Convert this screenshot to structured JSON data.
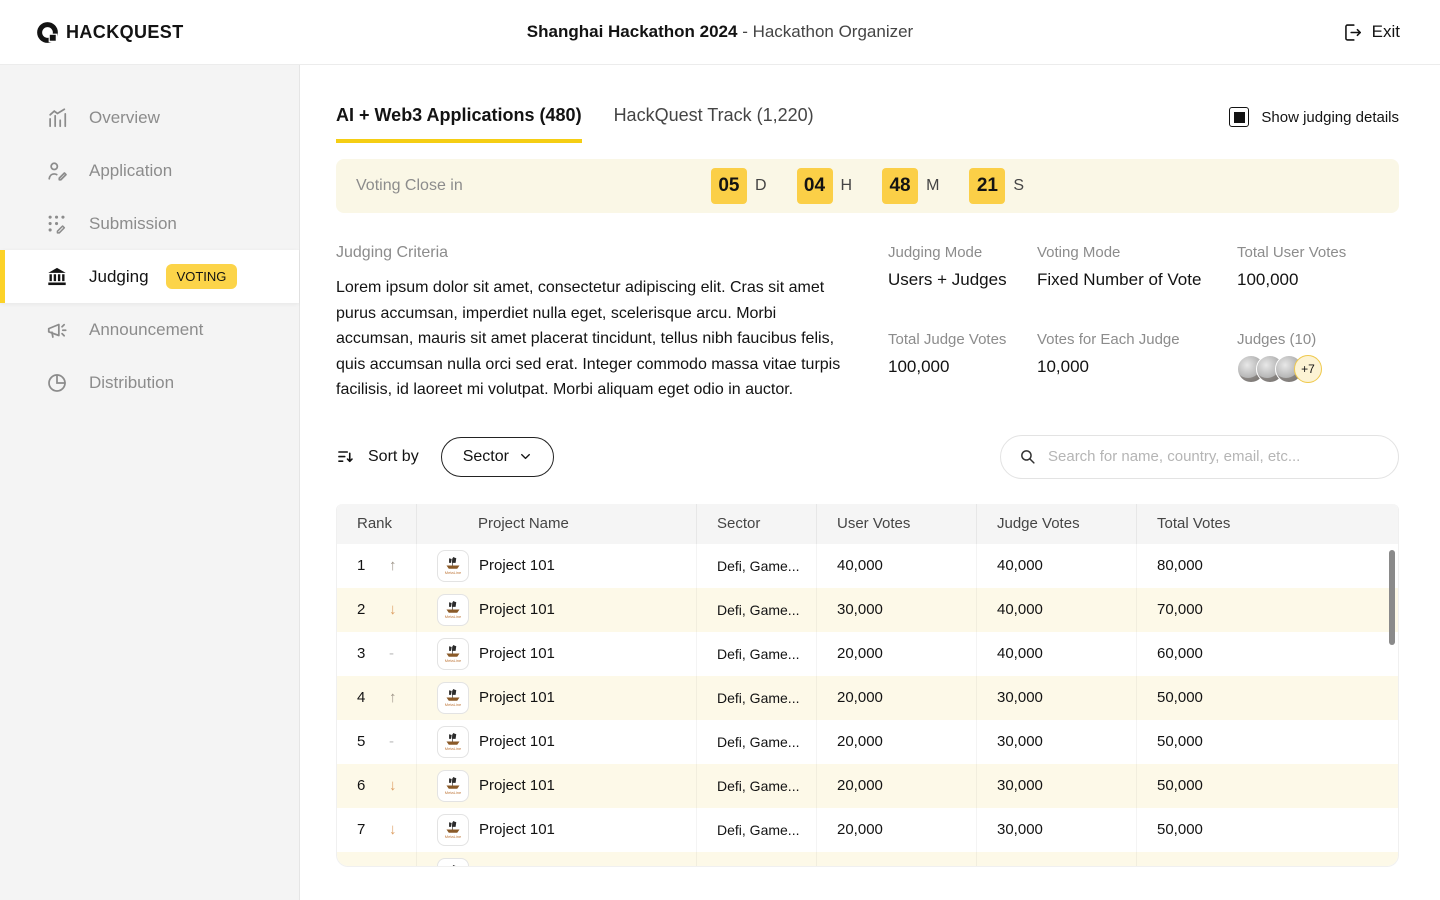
{
  "header": {
    "logo_text": "HACKQUEST",
    "title": "Shanghai Hackathon 2024",
    "subtitle": " - Hackathon Organizer",
    "exit_label": "Exit"
  },
  "sidebar": {
    "items": [
      {
        "label": "Overview",
        "icon": "chart-icon",
        "active": false
      },
      {
        "label": "Application",
        "icon": "user-edit-icon",
        "active": false
      },
      {
        "label": "Submission",
        "icon": "grid-edit-icon",
        "active": false
      },
      {
        "label": "Judging",
        "icon": "courthouse-icon",
        "active": true,
        "badge": "VOTING"
      },
      {
        "label": "Announcement",
        "icon": "megaphone-icon",
        "active": false
      },
      {
        "label": "Distribution",
        "icon": "pie-chart-icon",
        "active": false
      }
    ]
  },
  "tabs": [
    {
      "label": "AI + Web3 Applications (480)",
      "active": true
    },
    {
      "label": "HackQuest Track (1,220)",
      "active": false
    }
  ],
  "show_judging_details": {
    "label": "Show judging details",
    "checked": true
  },
  "countdown": {
    "label": "Voting Close in",
    "units": [
      {
        "value": "05",
        "unit": "D"
      },
      {
        "value": "04",
        "unit": "H"
      },
      {
        "value": "48",
        "unit": "M"
      },
      {
        "value": "21",
        "unit": "S"
      }
    ]
  },
  "criteria": {
    "label": "Judging Criteria",
    "text": "Lorem ipsum dolor sit amet, consectetur adipiscing elit. Cras sit amet purus accumsan, imperdiet nulla eget, scelerisque arcu. Morbi accumsan, mauris sit amet placerat tincidunt, tellus nibh faucibus felis, quis accumsan nulla orci sed erat. Integer commodo massa vitae turpis facilisis, id laoreet mi volutpat. Morbi aliquam eget odio in auctor."
  },
  "stats": [
    {
      "label": "Judging Mode",
      "value": "Users + Judges"
    },
    {
      "label": "Voting Mode",
      "value": "Fixed Number of Vote"
    },
    {
      "label": "Total User Votes",
      "value": "100,000"
    },
    {
      "label": "Total Judge Votes",
      "value": "100,000"
    },
    {
      "label": "Votes for Each Judge",
      "value": "10,000"
    },
    {
      "label": "Judges (10)",
      "value": "",
      "avatars_shown": 3,
      "overflow_badge": "+7"
    }
  ],
  "sort": {
    "label": "Sort by",
    "selected": "Sector"
  },
  "search": {
    "placeholder": "Search for name, country, email, etc..."
  },
  "icons": {
    "trend_up": "↑",
    "trend_down": "↓",
    "trend_flat": "-",
    "none": ""
  },
  "colors": {
    "accent_yellow": "#FCD449",
    "tab_underline": "#F5CE14",
    "banner_bg": "#FAF7E6",
    "row_alt_bg": "#FDF9E8",
    "sidebar_bg": "#F4F4F4",
    "trend_down_orange": "#DD9E62"
  },
  "table": {
    "columns": [
      "Rank",
      "Project Name",
      "Sector",
      "User Votes",
      "Judge Votes",
      "Total Votes"
    ],
    "logo_label": "MetaLine",
    "rows": [
      {
        "rank": "1",
        "trend": "trend_up",
        "name": "Project 101",
        "sector": "Defi, Game...",
        "user_votes": "40,000",
        "judge_votes": "40,000",
        "total_votes": "80,000"
      },
      {
        "rank": "2",
        "trend": "trend_down",
        "name": "Project 101",
        "sector": "Defi, Game...",
        "user_votes": "30,000",
        "judge_votes": "40,000",
        "total_votes": "70,000"
      },
      {
        "rank": "3",
        "trend": "trend_flat",
        "name": "Project 101",
        "sector": "Defi, Game...",
        "user_votes": "20,000",
        "judge_votes": "40,000",
        "total_votes": "60,000"
      },
      {
        "rank": "4",
        "trend": "trend_up",
        "name": "Project 101",
        "sector": "Defi, Game...",
        "user_votes": "20,000",
        "judge_votes": "30,000",
        "total_votes": "50,000"
      },
      {
        "rank": "5",
        "trend": "trend_flat",
        "name": "Project 101",
        "sector": "Defi, Game...",
        "user_votes": "20,000",
        "judge_votes": "30,000",
        "total_votes": "50,000"
      },
      {
        "rank": "6",
        "trend": "trend_down",
        "name": "Project 101",
        "sector": "Defi, Game...",
        "user_votes": "20,000",
        "judge_votes": "30,000",
        "total_votes": "50,000"
      },
      {
        "rank": "7",
        "trend": "trend_down",
        "name": "Project 101",
        "sector": "Defi, Game...",
        "user_votes": "20,000",
        "judge_votes": "30,000",
        "total_votes": "50,000"
      },
      {
        "rank": "",
        "trend": "none",
        "name": "",
        "sector": "",
        "user_votes": "",
        "judge_votes": "",
        "total_votes": "",
        "partial": true
      }
    ]
  }
}
